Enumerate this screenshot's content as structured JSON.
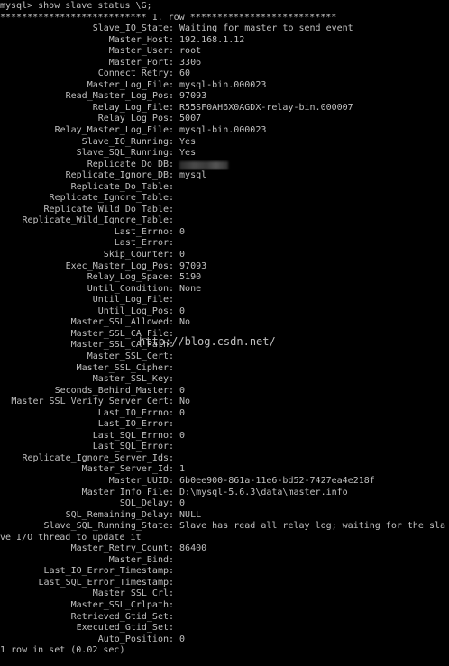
{
  "terminal": {
    "prompt_command": "mysql> show slave status \\G;",
    "row_header": "*************************** 1. row ***************************",
    "fields": [
      {
        "name": "Slave_IO_State",
        "value": "Waiting for master to send event"
      },
      {
        "name": "Master_Host",
        "value": "192.168.1.12"
      },
      {
        "name": "Master_User",
        "value": "root"
      },
      {
        "name": "Master_Port",
        "value": "3306"
      },
      {
        "name": "Connect_Retry",
        "value": "60"
      },
      {
        "name": "Master_Log_File",
        "value": "mysql-bin.000023"
      },
      {
        "name": "Read_Master_Log_Pos",
        "value": "97093"
      },
      {
        "name": "Relay_Log_File",
        "value": "R55SF0AH6X0AGDX-relay-bin.000007"
      },
      {
        "name": "Relay_Log_Pos",
        "value": "5007"
      },
      {
        "name": "Relay_Master_Log_File",
        "value": "mysql-bin.000023"
      },
      {
        "name": "Slave_IO_Running",
        "value": "Yes"
      },
      {
        "name": "Slave_SQL_Running",
        "value": "Yes"
      },
      {
        "name": "Replicate_Do_DB",
        "value": ""
      },
      {
        "name": "Replicate_Ignore_DB",
        "value": "mysql"
      },
      {
        "name": "Replicate_Do_Table",
        "value": ""
      },
      {
        "name": "Replicate_Ignore_Table",
        "value": ""
      },
      {
        "name": "Replicate_Wild_Do_Table",
        "value": ""
      },
      {
        "name": "Replicate_Wild_Ignore_Table",
        "value": ""
      },
      {
        "name": "Last_Errno",
        "value": "0"
      },
      {
        "name": "Last_Error",
        "value": ""
      },
      {
        "name": "Skip_Counter",
        "value": "0"
      },
      {
        "name": "Exec_Master_Log_Pos",
        "value": "97093"
      },
      {
        "name": "Relay_Log_Space",
        "value": "5190"
      },
      {
        "name": "Until_Condition",
        "value": "None"
      },
      {
        "name": "Until_Log_File",
        "value": ""
      },
      {
        "name": "Until_Log_Pos",
        "value": "0"
      },
      {
        "name": "Master_SSL_Allowed",
        "value": "No"
      },
      {
        "name": "Master_SSL_CA_File",
        "value": ""
      },
      {
        "name": "Master_SSL_CA_Path",
        "value": ""
      },
      {
        "name": "Master_SSL_Cert",
        "value": ""
      },
      {
        "name": "Master_SSL_Cipher",
        "value": ""
      },
      {
        "name": "Master_SSL_Key",
        "value": ""
      },
      {
        "name": "Seconds_Behind_Master",
        "value": "0"
      },
      {
        "name": "Master_SSL_Verify_Server_Cert",
        "value": "No"
      },
      {
        "name": "Last_IO_Errno",
        "value": "0"
      },
      {
        "name": "Last_IO_Error",
        "value": ""
      },
      {
        "name": "Last_SQL_Errno",
        "value": "0"
      },
      {
        "name": "Last_SQL_Error",
        "value": ""
      },
      {
        "name": "Replicate_Ignore_Server_Ids",
        "value": ""
      },
      {
        "name": "Master_Server_Id",
        "value": "1"
      },
      {
        "name": "Master_UUID",
        "value": "6b0ee900-861a-11e6-bd52-7427ea4e218f"
      },
      {
        "name": "Master_Info_File",
        "value": "D:\\mysql-5.6.3\\data\\master.info"
      },
      {
        "name": "SQL_Delay",
        "value": "0"
      },
      {
        "name": "SQL_Remaining_Delay",
        "value": "NULL"
      },
      {
        "name": "Slave_SQL_Running_State",
        "value": "Slave has read all relay log; waiting for the sla"
      },
      {
        "name": "Master_Retry_Count",
        "value": "86400"
      },
      {
        "name": "Master_Bind",
        "value": ""
      },
      {
        "name": "Last_IO_Error_Timestamp",
        "value": ""
      },
      {
        "name": "Last_SQL_Error_Timestamp",
        "value": ""
      },
      {
        "name": "Master_SSL_Crl",
        "value": ""
      },
      {
        "name": "Master_SSL_Crlpath",
        "value": ""
      },
      {
        "name": "Retrieved_Gtid_Set",
        "value": ""
      },
      {
        "name": "Executed_Gtid_Set",
        "value": ""
      },
      {
        "name": "Auto_Position",
        "value": "0"
      }
    ],
    "wrap_line": "ve I/O thread to update it",
    "footer": "1 row in set (0.02 sec)",
    "watermark": "http://blog.csdn.net/"
  }
}
